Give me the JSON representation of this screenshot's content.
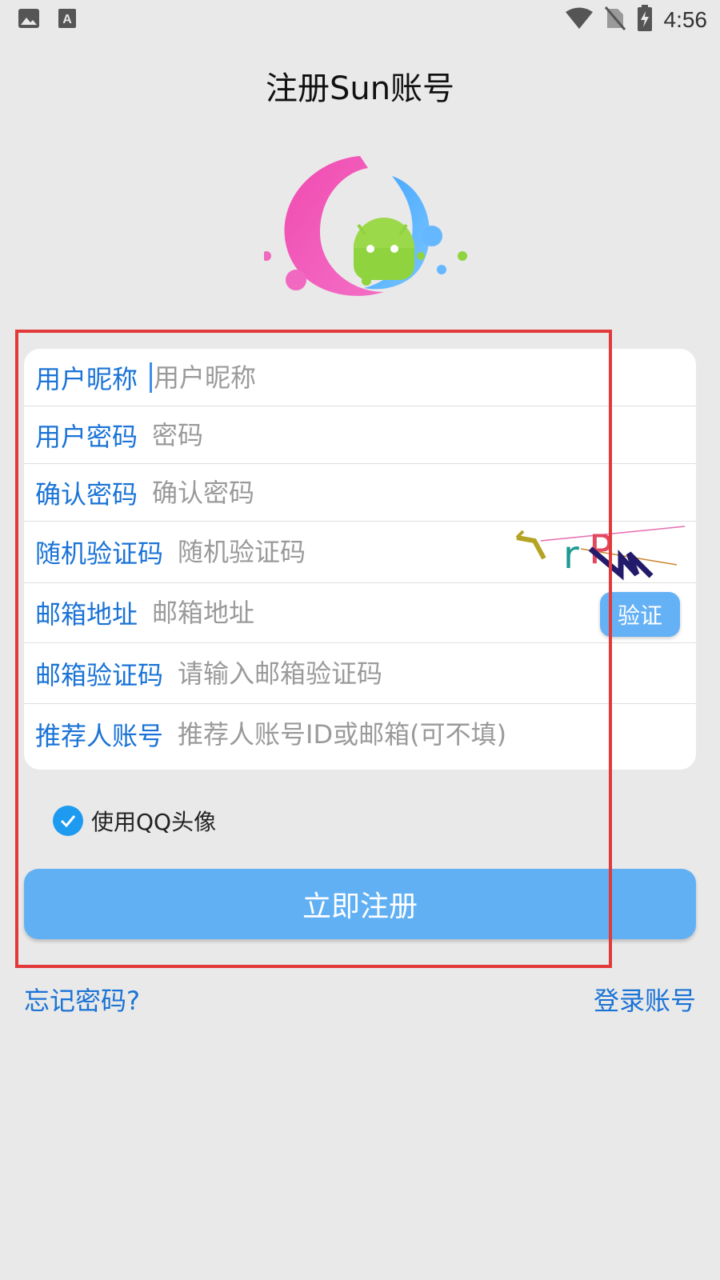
{
  "status_bar": {
    "time": "4:56",
    "icons": [
      "image-icon",
      "font-icon",
      "wifi-icon",
      "no-sim-icon",
      "battery-charging-icon"
    ]
  },
  "page": {
    "title": "注册Sun账号"
  },
  "form": {
    "rows": [
      {
        "label": "用户昵称",
        "placeholder": "用户昵称",
        "value": ""
      },
      {
        "label": "用户密码",
        "placeholder": "密码",
        "value": ""
      },
      {
        "label": "确认密码",
        "placeholder": "确认密码",
        "value": ""
      },
      {
        "label": "随机验证码",
        "placeholder": "随机验证码",
        "value": "",
        "captcha_text": "rPM"
      },
      {
        "label": "邮箱地址",
        "placeholder": "邮箱地址",
        "value": "",
        "button": "验证"
      },
      {
        "label": "邮箱验证码",
        "placeholder": "请输入邮箱验证码",
        "value": ""
      },
      {
        "label": "推荐人账号",
        "placeholder": "推荐人账号ID或邮箱(可不填)",
        "value": ""
      }
    ]
  },
  "options": {
    "use_qq_avatar_label": "使用QQ头像",
    "use_qq_avatar_checked": true
  },
  "actions": {
    "register": "立即注册"
  },
  "links": {
    "forgot_password": "忘记密码?",
    "login": "登录账号"
  },
  "colors": {
    "accent": "#1a73d6",
    "button": "#62b0f4",
    "highlight_box": "#e23a3a",
    "background": "#e9e9e9"
  }
}
